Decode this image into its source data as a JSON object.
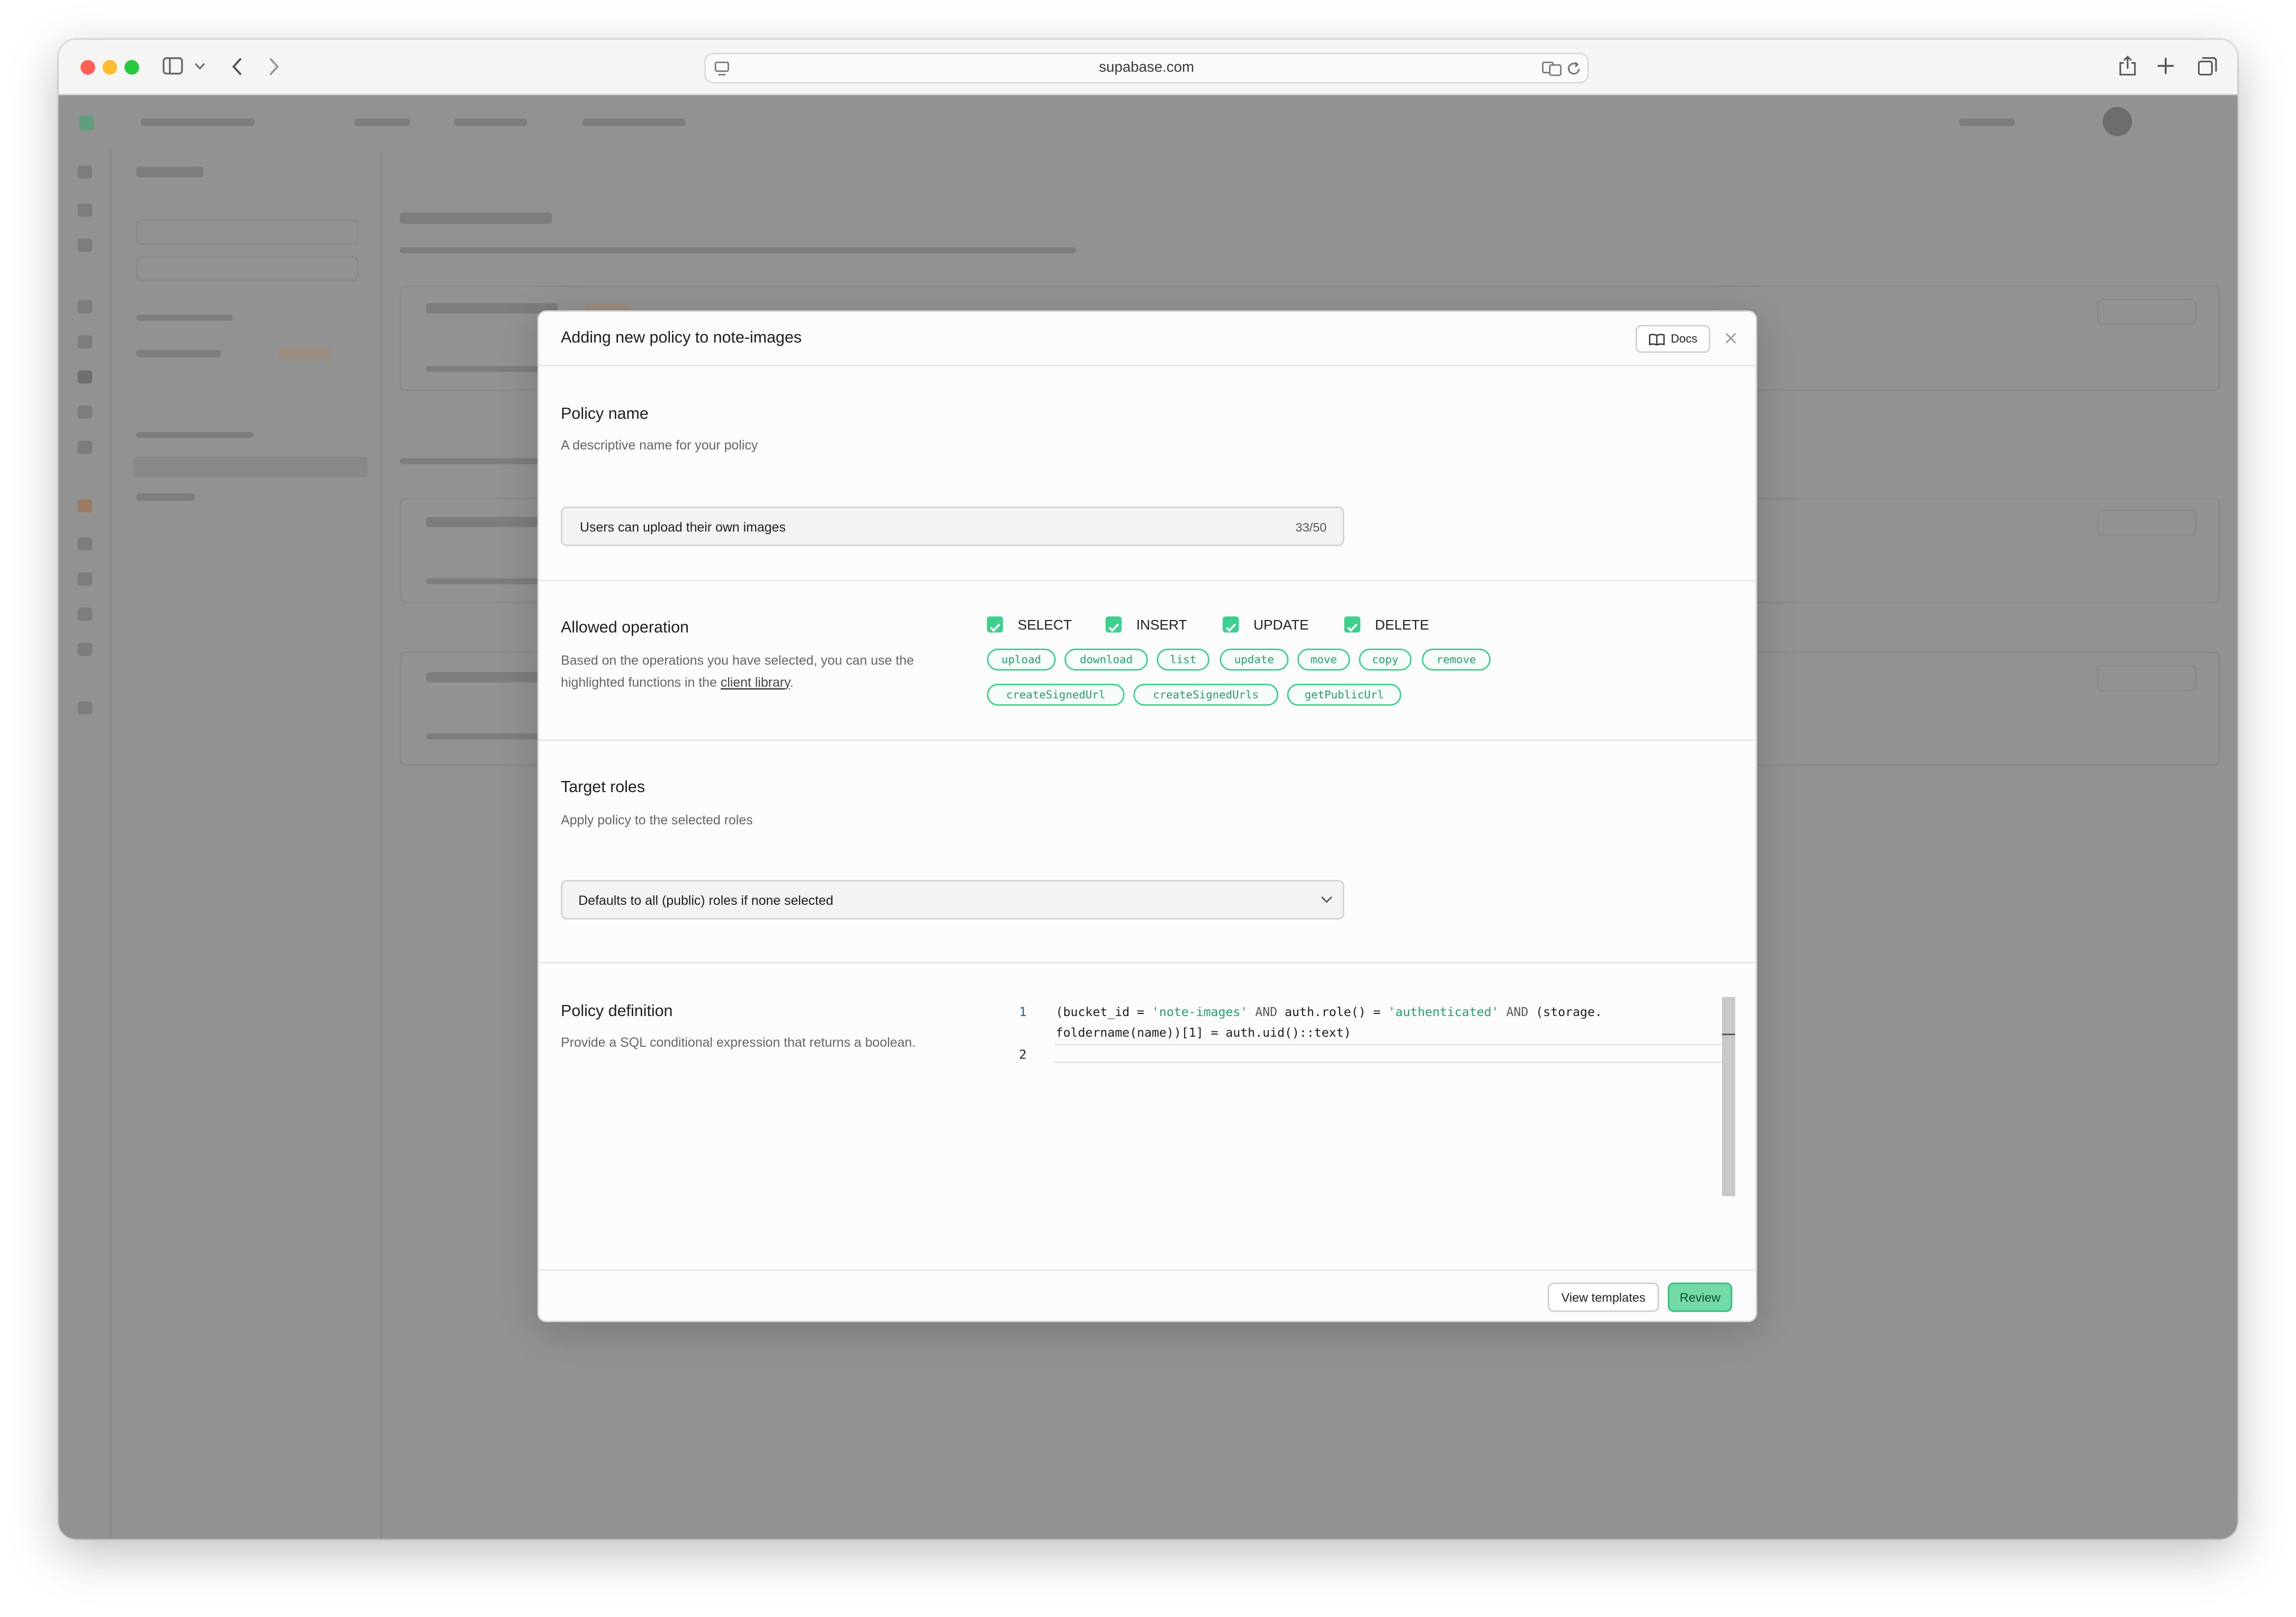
{
  "browser": {
    "url": "supabase.com",
    "icons": [
      "sidebar-toggle-icon",
      "chevron-down-icon",
      "back-arrow-icon",
      "forward-arrow-icon",
      "site-settings-icon",
      "translate-icon",
      "reload-icon",
      "share-icon",
      "new-tab-icon",
      "tab-overview-icon"
    ]
  },
  "modal": {
    "title": "Adding new policy to note-images",
    "docs_label": "Docs",
    "policy_name": {
      "label": "Policy name",
      "hint": "A descriptive name for your policy",
      "value": "Users can upload their own images",
      "counter": "33/50"
    },
    "allowed_operation": {
      "label": "Allowed operation",
      "hint_prefix": "Based on the operations you have selected, you can use the highlighted functions in the ",
      "hint_link": "client library",
      "hint_suffix": ".",
      "operations": [
        {
          "label": "SELECT",
          "checked": true
        },
        {
          "label": "INSERT",
          "checked": true
        },
        {
          "label": "UPDATE",
          "checked": true
        },
        {
          "label": "DELETE",
          "checked": true
        }
      ],
      "functions": [
        "upload",
        "download",
        "list",
        "update",
        "move",
        "copy",
        "remove",
        "createSignedUrl",
        "createSignedUrls",
        "getPublicUrl"
      ]
    },
    "target_roles": {
      "label": "Target roles",
      "hint": "Apply policy to the selected roles",
      "placeholder": "Defaults to all (public) roles if none selected"
    },
    "policy_definition": {
      "label": "Policy definition",
      "hint": "Provide a SQL conditional expression that returns a boolean.",
      "line_numbers": [
        "1",
        "2"
      ],
      "code_line1": {
        "t1": "(bucket_id = ",
        "s1": "'note-images'",
        "k1": " AND ",
        "t2": "auth.role() = ",
        "s2": "'authenticated'",
        "k2": " AND ",
        "t3": "(storage."
      },
      "code_line1_wrap": "foldername(name))[1] = auth.uid()::text)"
    },
    "footer": {
      "templates_label": "View templates",
      "review_label": "Review"
    },
    "accent_color": "#3ecf8e"
  }
}
